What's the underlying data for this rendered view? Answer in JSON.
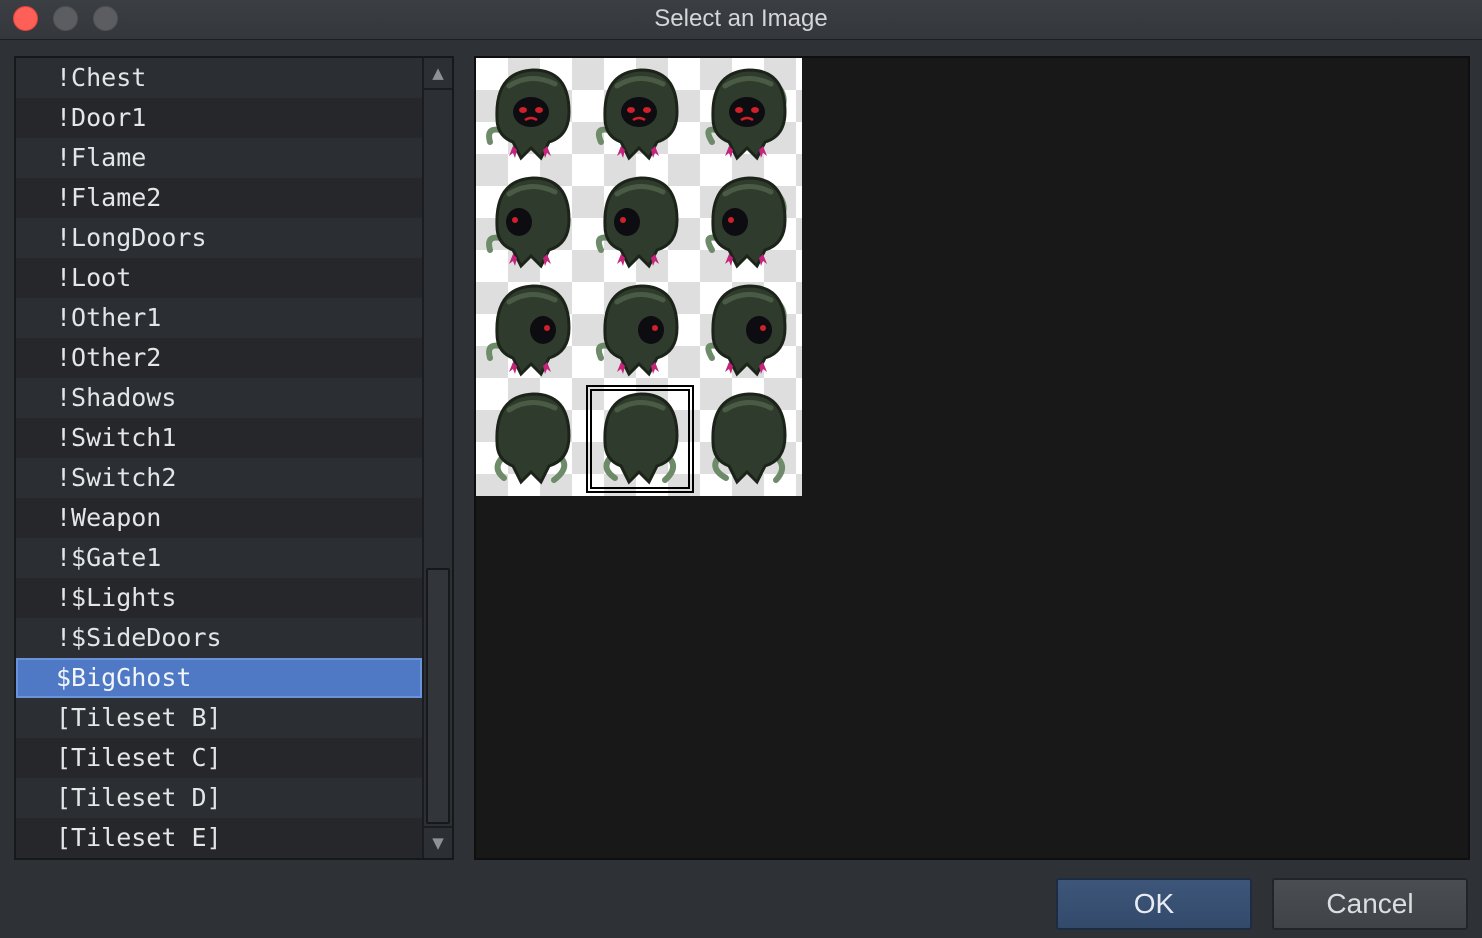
{
  "window": {
    "title": "Select an Image"
  },
  "file_list": {
    "items": [
      {
        "label": "!Chest"
      },
      {
        "label": "!Door1"
      },
      {
        "label": "!Flame"
      },
      {
        "label": "!Flame2"
      },
      {
        "label": "!LongDoors"
      },
      {
        "label": "!Loot"
      },
      {
        "label": "!Other1"
      },
      {
        "label": "!Other2"
      },
      {
        "label": "!Shadows"
      },
      {
        "label": "!Switch1"
      },
      {
        "label": "!Switch2"
      },
      {
        "label": "!Weapon"
      },
      {
        "label": "!$Gate1"
      },
      {
        "label": "!$Lights"
      },
      {
        "label": "!$SideDoors"
      },
      {
        "label": "$BigGhost"
      },
      {
        "label": "[Tileset B]"
      },
      {
        "label": "[Tileset C]"
      },
      {
        "label": "[Tileset D]"
      },
      {
        "label": "[Tileset E]"
      }
    ],
    "selected_label": "$BigGhost"
  },
  "preview": {
    "rows": 4,
    "columns": 3,
    "selected_row": 4,
    "selected_column": 2
  },
  "buttons": {
    "ok": "OK",
    "cancel": "Cancel"
  },
  "colors": {
    "selection": "#4f79c5",
    "close": "#fe5f57"
  }
}
